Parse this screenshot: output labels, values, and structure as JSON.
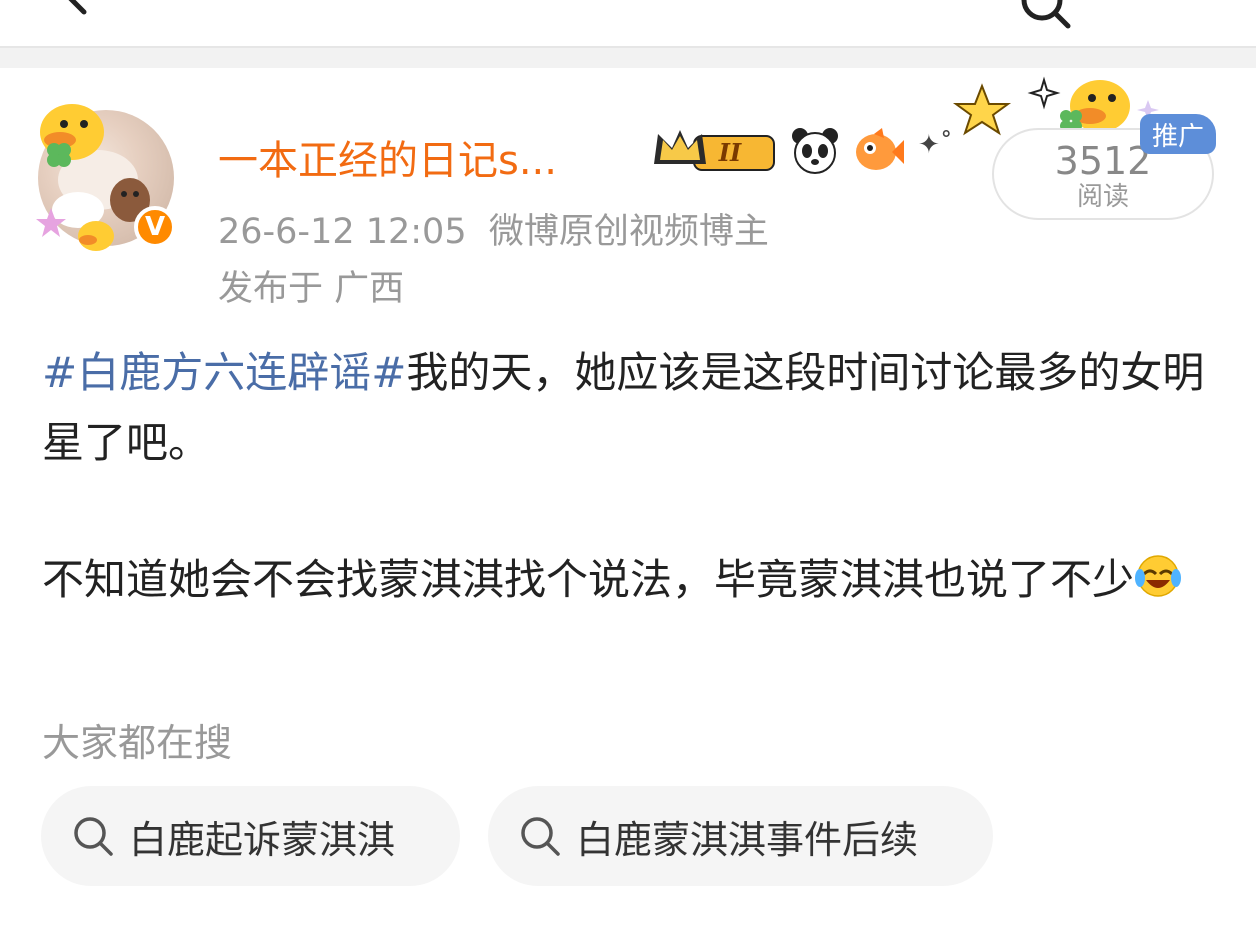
{
  "post": {
    "username": "一本正经的日记s...",
    "level_badge": "II",
    "timestamp": "26-6-12 12:05",
    "author_tag": "微博原创视频博主",
    "location": "发布于 广西",
    "read_count": "3512",
    "read_label": "阅读",
    "promo_label": "推广",
    "verified_mark": "V",
    "hashtag": "#白鹿方六连辟谣#",
    "paragraph1_rest": "我的天，她应该是这段时间讨论最多的女明星了吧。",
    "paragraph2": "不知道她会不会找蒙淇淇找个说法，毕竟蒙淇淇也说了不少"
  },
  "search": {
    "title": "大家都在搜",
    "chips": [
      {
        "label": "白鹿起诉蒙淇淇"
      },
      {
        "label": "白鹿蒙淇淇事件后续"
      }
    ]
  },
  "icons": {
    "back": "back-arrow-icon",
    "search": "search-icon",
    "crown": "crown-badge-icon",
    "panda": "panda-icon",
    "fish": "fish-icon",
    "emoji": "laughing-crying-emoji-icon"
  },
  "colors": {
    "username": "#f26b12",
    "hashtag": "#4a6da7",
    "verified": "#ff8a00",
    "promo": "#5d8ed9"
  }
}
